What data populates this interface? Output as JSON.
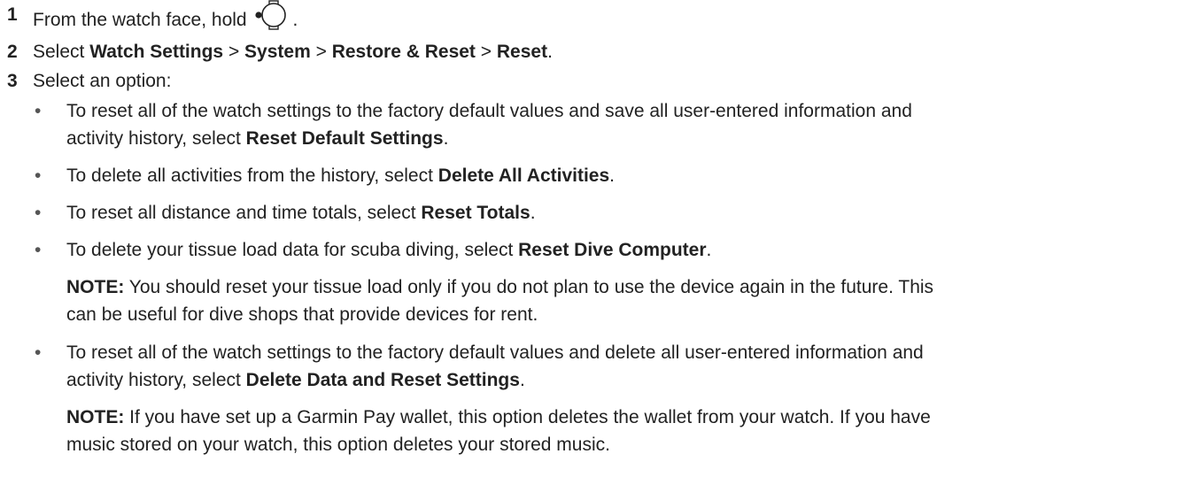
{
  "steps": [
    {
      "number": "1",
      "text": "From the watch face, hold",
      "icon": "watch-button-icon",
      "suffix": "."
    },
    {
      "number": "2",
      "prefix": "Select ",
      "path": [
        "Watch Settings",
        "System",
        "Restore & Reset",
        "Reset"
      ],
      "separator": " > ",
      "suffix": "."
    },
    {
      "number": "3",
      "text": "Select an option:"
    }
  ],
  "options": [
    {
      "lines": [
        "To reset all of the watch settings to the factory default values and save all user-entered information and",
        "activity history, select "
      ],
      "bold": "Reset Default Settings",
      "suffix": "."
    },
    {
      "text": "To delete all activities from the history, select ",
      "bold": "Delete All Activities",
      "suffix": "."
    },
    {
      "text": "To reset all distance and time totals, select ",
      "bold": "Reset Totals",
      "suffix": "."
    },
    {
      "text": "To delete your tissue load data for scuba diving, select ",
      "bold": "Reset Dive Computer",
      "suffix": ".",
      "note": {
        "label": "NOTE:",
        "lines": [
          " You should reset your tissue load only if you do not plan to use the device again in the future. This",
          "can be useful for dive shops that provide devices for rent."
        ]
      }
    },
    {
      "lines": [
        "To reset all of the watch settings to the factory default values and delete all user-entered information and",
        "activity history, select "
      ],
      "bold": "Delete Data and Reset Settings",
      "suffix": ".",
      "note": {
        "label": "NOTE:",
        "lines": [
          " If you have set up a Garmin Pay wallet, this option deletes the wallet from your watch. If you have",
          "music stored on your watch, this option deletes your stored music."
        ]
      }
    }
  ],
  "bullet_char": "•"
}
